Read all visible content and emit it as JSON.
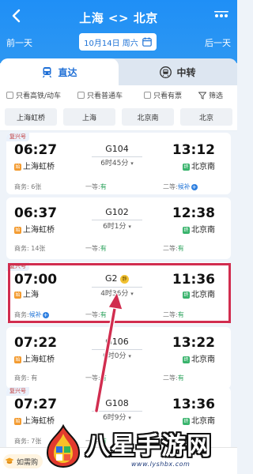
{
  "header": {
    "title": "上海 <> 北京",
    "prev_day": "前一天",
    "next_day": "后一天",
    "date": "10月14日 周六"
  },
  "tabs": [
    {
      "label": "直达",
      "active": true
    },
    {
      "label": "中转",
      "active": false
    }
  ],
  "filters": [
    {
      "label": "只看高铁/动车"
    },
    {
      "label": "只看普通车"
    },
    {
      "label": "只看有票"
    },
    {
      "label": "筛选"
    }
  ],
  "stations": [
    "上海虹桥",
    "上海",
    "北京南",
    "北京"
  ],
  "trains": [
    {
      "tag": "复兴号",
      "dep_time": "06:27",
      "arr_time": "13:12",
      "train_no": "G104",
      "duration": "6时45分",
      "dep_station": "上海虹桥",
      "dep_badge": "始",
      "arr_station": "北京南",
      "arr_badge": "终",
      "seat_business": "商务: 6张",
      "seat_first_label": "一等:",
      "seat_first_value": "有",
      "seat_second_label": "二等:",
      "seat_second_value": "候补"
    },
    {
      "tag": "",
      "dep_time": "06:37",
      "arr_time": "12:38",
      "train_no": "G102",
      "duration": "6时1分",
      "dep_station": "上海虹桥",
      "dep_badge": "始",
      "arr_station": "北京南",
      "arr_badge": "终",
      "seat_business": "商务: 14张",
      "seat_first_label": "一等:",
      "seat_first_value": "有",
      "seat_second_label": "二等:",
      "seat_second_value": "有"
    },
    {
      "tag": "复兴号",
      "dep_time": "07:00",
      "arr_time": "11:36",
      "train_no": "G2",
      "quiet_badge": "静",
      "duration": "4时36分",
      "dep_station": "上海",
      "dep_badge": "始",
      "arr_station": "北京南",
      "arr_badge": "终",
      "seat_business_label": "商务:",
      "seat_business_value": "候补",
      "seat_first_label": "一等:",
      "seat_first_value": "有",
      "seat_second_label": "二等:",
      "seat_second_value": "有"
    },
    {
      "tag": "",
      "dep_time": "07:22",
      "arr_time": "13:22",
      "train_no": "G106",
      "duration": "6时0分",
      "dep_station": "上海虹桥",
      "dep_badge": "始",
      "arr_station": "北京南",
      "arr_badge": "终",
      "seat_business": "商务: 有",
      "seat_first_label": "一等:",
      "seat_first_value": "有",
      "seat_second_label": "二等:",
      "seat_second_value": "有"
    },
    {
      "tag": "复兴号",
      "dep_time": "07:27",
      "arr_time": "13:36",
      "train_no": "G108",
      "duration": "6时9分",
      "dep_station": "上海虹桥",
      "dep_badge": "始",
      "arr_station": "北京南",
      "arr_badge": "终",
      "seat_business": "商务: 7张",
      "seat_first_label": "一等:",
      "seat_first_value": "有",
      "seat_second_label": "二等:",
      "seat_second_value": "有"
    }
  ],
  "bottom": {
    "hint": "如需购"
  },
  "watermark": {
    "title": "八星手游网",
    "url": "www.lyshbx.com"
  },
  "colors": {
    "header_blue": "#1f8ff6",
    "highlight_red": "#d12d4f",
    "available_green": "#2aa25b",
    "waitlist_blue": "#1f73d6"
  }
}
